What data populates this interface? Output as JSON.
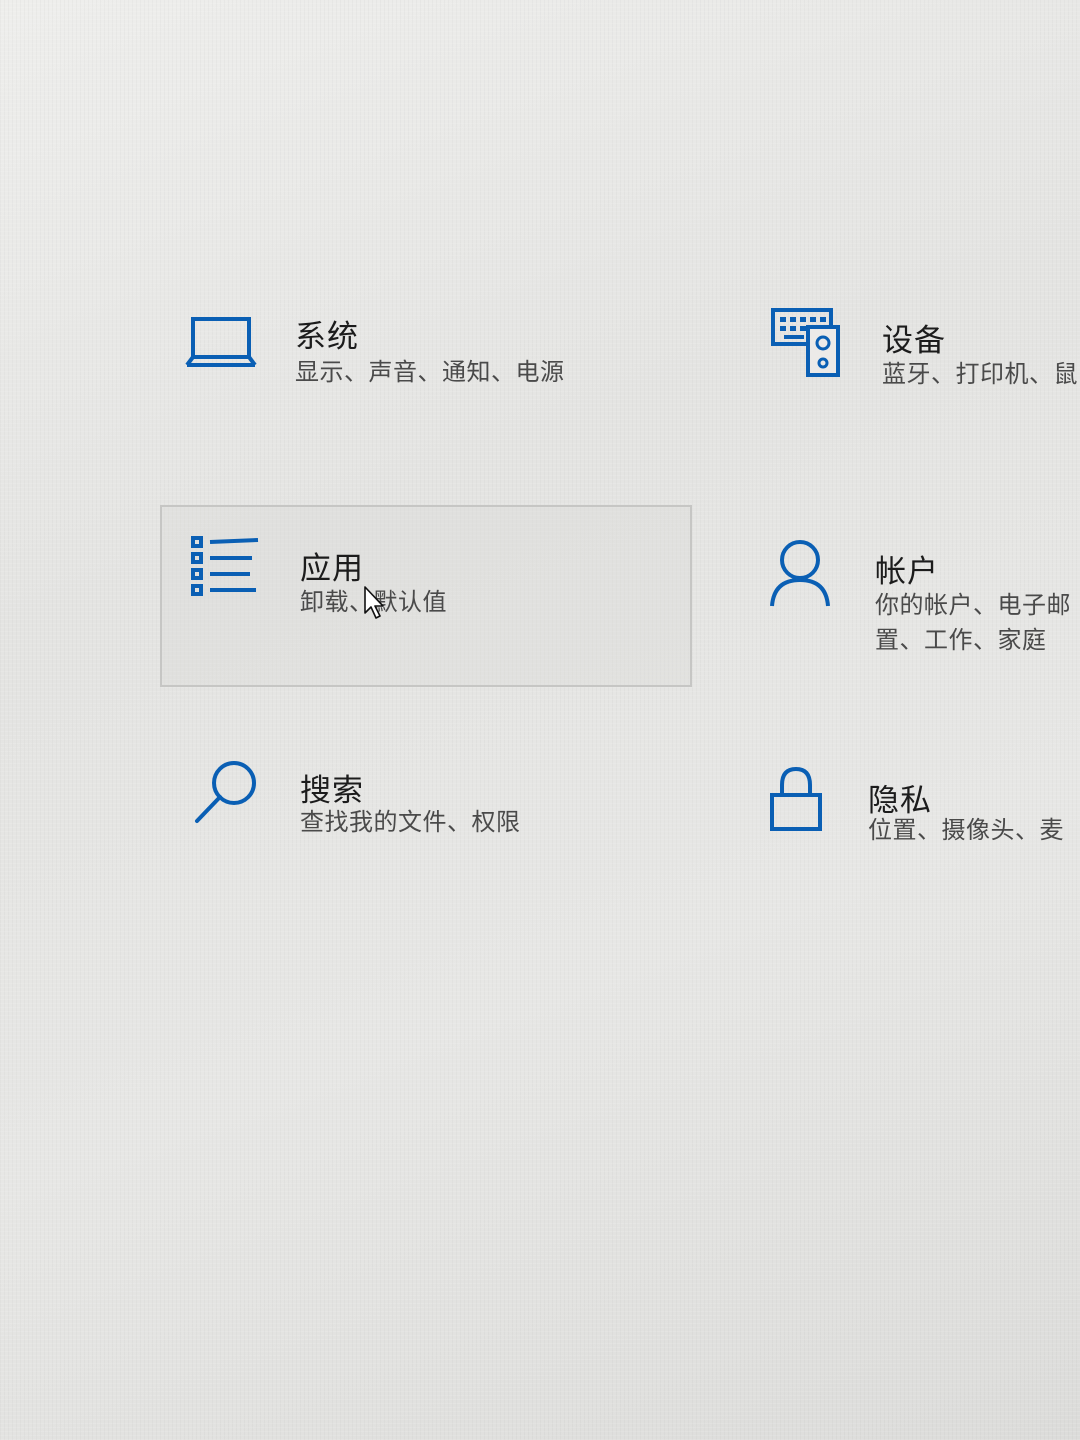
{
  "accent_color": "#0a5fb4",
  "tiles": [
    {
      "title": "系统",
      "desc": "显示、声音、通知、电源",
      "icon": "laptop-icon"
    },
    {
      "title": "设备",
      "desc": "蓝牙、打印机、鼠",
      "icon": "keyboard-speaker-icon"
    },
    {
      "title": "应用",
      "desc": "卸载、默认值",
      "icon": "app-list-icon",
      "state": "selected"
    },
    {
      "title": "帐户",
      "desc": "你的帐户、电子邮",
      "desc2": "置、工作、家庭",
      "icon": "person-icon"
    },
    {
      "title": "搜索",
      "desc": "查找我的文件、权限",
      "icon": "search-icon"
    },
    {
      "title": "隐私",
      "desc": "位置、摄像头、麦",
      "icon": "lock-icon"
    }
  ]
}
